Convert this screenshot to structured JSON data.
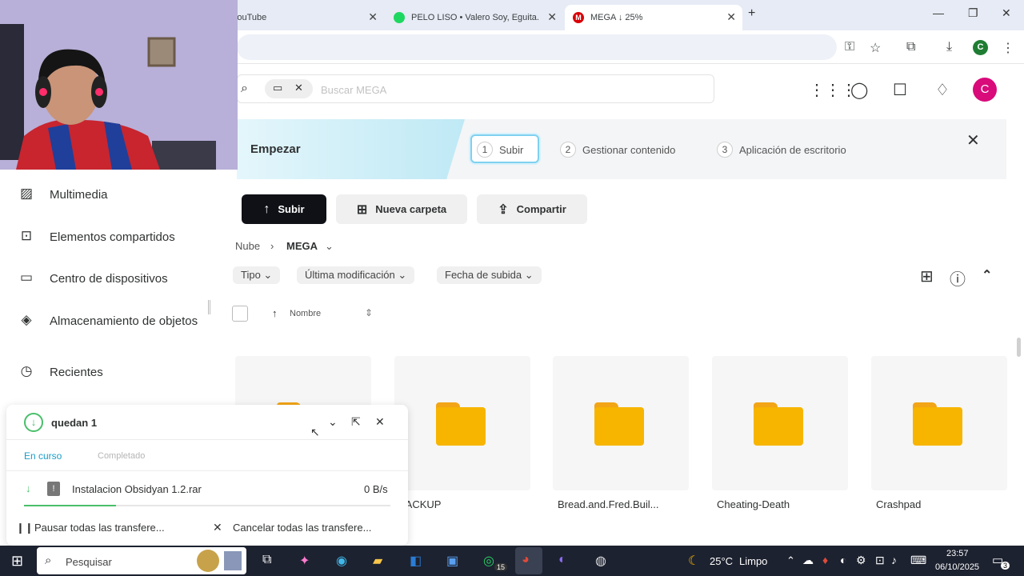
{
  "browser": {
    "tabs": [
      {
        "title": "YouTube",
        "color": "#e62117"
      },
      {
        "title": "PELO LISO • Valero Soy, Eguita...",
        "color": "#1ed760"
      },
      {
        "title": "MEGA ↓ 25%",
        "color": "#d90007"
      }
    ],
    "new_tab": "+",
    "profile_initial": "C"
  },
  "header": {
    "search_placeholder": "Buscar MEGA",
    "avatar_initial": "C"
  },
  "onboarding": {
    "title": "Empezar",
    "steps": [
      {
        "num": "1",
        "label": "Subir"
      },
      {
        "num": "2",
        "label": "Gestionar contenido"
      },
      {
        "num": "3",
        "label": "Aplicación de escritorio"
      }
    ]
  },
  "sidebar": {
    "items": [
      {
        "label": "Multimedia",
        "icon": "image-icon"
      },
      {
        "label": "Elementos compartidos",
        "icon": "shared-folder-icon"
      },
      {
        "label": "Centro de dispositivos",
        "icon": "devices-icon"
      },
      {
        "label": "Almacenamiento de objetos",
        "icon": "object-storage-icon"
      },
      {
        "label": "Recientes",
        "icon": "clock-icon"
      }
    ]
  },
  "actions": {
    "upload": "Subir",
    "new_folder": "Nueva carpeta",
    "share": "Compartir"
  },
  "breadcrumb": {
    "root": "Nube",
    "current": "MEGA"
  },
  "filters": [
    "Tipo",
    "Última modificación",
    "Fecha de subida"
  ],
  "list_header": {
    "name": "Nombre"
  },
  "folders": [
    "BACKUP",
    "Bread.and.Fred.Buil...",
    "Cheating-Death",
    "Crashpad"
  ],
  "transfers": {
    "title": "quedan 1",
    "tab_active": "En curso",
    "tab_done": "Completado",
    "item_name": "Instalacion Obsidyan 1.2.rar",
    "item_speed": "0 B/s",
    "progress": 0.25,
    "pause_all": "Pausar todas las transfere...",
    "cancel_all": "Cancelar todas las transfere..."
  },
  "taskbar": {
    "search": "Pesquisar",
    "weather_temp": "25°C",
    "weather_desc": "Limpo",
    "time": "23:57",
    "date": "06/10/2025",
    "whatsapp_badge": "15",
    "notif_badge": "3"
  }
}
